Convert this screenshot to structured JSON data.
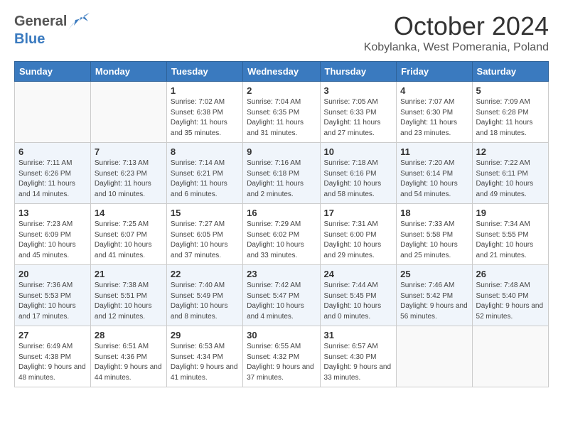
{
  "header": {
    "logo_general": "General",
    "logo_blue": "Blue",
    "month_title": "October 2024",
    "location": "Kobylanka, West Pomerania, Poland"
  },
  "days_of_week": [
    "Sunday",
    "Monday",
    "Tuesday",
    "Wednesday",
    "Thursday",
    "Friday",
    "Saturday"
  ],
  "weeks": [
    [
      {
        "day": "",
        "info": ""
      },
      {
        "day": "",
        "info": ""
      },
      {
        "day": "1",
        "info": "Sunrise: 7:02 AM\nSunset: 6:38 PM\nDaylight: 11 hours and 35 minutes."
      },
      {
        "day": "2",
        "info": "Sunrise: 7:04 AM\nSunset: 6:35 PM\nDaylight: 11 hours and 31 minutes."
      },
      {
        "day": "3",
        "info": "Sunrise: 7:05 AM\nSunset: 6:33 PM\nDaylight: 11 hours and 27 minutes."
      },
      {
        "day": "4",
        "info": "Sunrise: 7:07 AM\nSunset: 6:30 PM\nDaylight: 11 hours and 23 minutes."
      },
      {
        "day": "5",
        "info": "Sunrise: 7:09 AM\nSunset: 6:28 PM\nDaylight: 11 hours and 18 minutes."
      }
    ],
    [
      {
        "day": "6",
        "info": "Sunrise: 7:11 AM\nSunset: 6:26 PM\nDaylight: 11 hours and 14 minutes."
      },
      {
        "day": "7",
        "info": "Sunrise: 7:13 AM\nSunset: 6:23 PM\nDaylight: 11 hours and 10 minutes."
      },
      {
        "day": "8",
        "info": "Sunrise: 7:14 AM\nSunset: 6:21 PM\nDaylight: 11 hours and 6 minutes."
      },
      {
        "day": "9",
        "info": "Sunrise: 7:16 AM\nSunset: 6:18 PM\nDaylight: 11 hours and 2 minutes."
      },
      {
        "day": "10",
        "info": "Sunrise: 7:18 AM\nSunset: 6:16 PM\nDaylight: 10 hours and 58 minutes."
      },
      {
        "day": "11",
        "info": "Sunrise: 7:20 AM\nSunset: 6:14 PM\nDaylight: 10 hours and 54 minutes."
      },
      {
        "day": "12",
        "info": "Sunrise: 7:22 AM\nSunset: 6:11 PM\nDaylight: 10 hours and 49 minutes."
      }
    ],
    [
      {
        "day": "13",
        "info": "Sunrise: 7:23 AM\nSunset: 6:09 PM\nDaylight: 10 hours and 45 minutes."
      },
      {
        "day": "14",
        "info": "Sunrise: 7:25 AM\nSunset: 6:07 PM\nDaylight: 10 hours and 41 minutes."
      },
      {
        "day": "15",
        "info": "Sunrise: 7:27 AM\nSunset: 6:05 PM\nDaylight: 10 hours and 37 minutes."
      },
      {
        "day": "16",
        "info": "Sunrise: 7:29 AM\nSunset: 6:02 PM\nDaylight: 10 hours and 33 minutes."
      },
      {
        "day": "17",
        "info": "Sunrise: 7:31 AM\nSunset: 6:00 PM\nDaylight: 10 hours and 29 minutes."
      },
      {
        "day": "18",
        "info": "Sunrise: 7:33 AM\nSunset: 5:58 PM\nDaylight: 10 hours and 25 minutes."
      },
      {
        "day": "19",
        "info": "Sunrise: 7:34 AM\nSunset: 5:55 PM\nDaylight: 10 hours and 21 minutes."
      }
    ],
    [
      {
        "day": "20",
        "info": "Sunrise: 7:36 AM\nSunset: 5:53 PM\nDaylight: 10 hours and 17 minutes."
      },
      {
        "day": "21",
        "info": "Sunrise: 7:38 AM\nSunset: 5:51 PM\nDaylight: 10 hours and 12 minutes."
      },
      {
        "day": "22",
        "info": "Sunrise: 7:40 AM\nSunset: 5:49 PM\nDaylight: 10 hours and 8 minutes."
      },
      {
        "day": "23",
        "info": "Sunrise: 7:42 AM\nSunset: 5:47 PM\nDaylight: 10 hours and 4 minutes."
      },
      {
        "day": "24",
        "info": "Sunrise: 7:44 AM\nSunset: 5:45 PM\nDaylight: 10 hours and 0 minutes."
      },
      {
        "day": "25",
        "info": "Sunrise: 7:46 AM\nSunset: 5:42 PM\nDaylight: 9 hours and 56 minutes."
      },
      {
        "day": "26",
        "info": "Sunrise: 7:48 AM\nSunset: 5:40 PM\nDaylight: 9 hours and 52 minutes."
      }
    ],
    [
      {
        "day": "27",
        "info": "Sunrise: 6:49 AM\nSunset: 4:38 PM\nDaylight: 9 hours and 48 minutes."
      },
      {
        "day": "28",
        "info": "Sunrise: 6:51 AM\nSunset: 4:36 PM\nDaylight: 9 hours and 44 minutes."
      },
      {
        "day": "29",
        "info": "Sunrise: 6:53 AM\nSunset: 4:34 PM\nDaylight: 9 hours and 41 minutes."
      },
      {
        "day": "30",
        "info": "Sunrise: 6:55 AM\nSunset: 4:32 PM\nDaylight: 9 hours and 37 minutes."
      },
      {
        "day": "31",
        "info": "Sunrise: 6:57 AM\nSunset: 4:30 PM\nDaylight: 9 hours and 33 minutes."
      },
      {
        "day": "",
        "info": ""
      },
      {
        "day": "",
        "info": ""
      }
    ]
  ]
}
